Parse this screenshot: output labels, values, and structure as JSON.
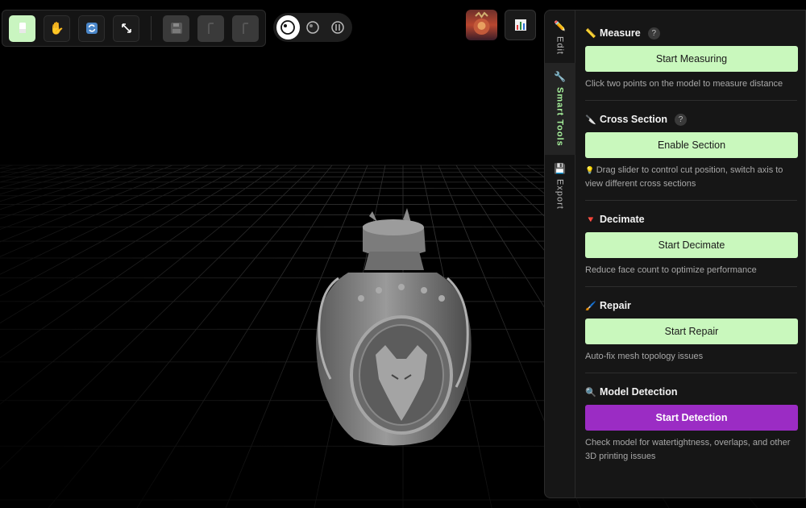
{
  "toolbar": {
    "tools": [
      {
        "name": "select-tool-button",
        "icon": "select-cursor-icon",
        "active": true
      },
      {
        "name": "pan-tool-button",
        "icon": "hand-icon"
      },
      {
        "name": "rotate-tool-button",
        "icon": "rotate-icon"
      },
      {
        "name": "scale-tool-button",
        "icon": "resize-arrows-icon"
      }
    ],
    "actions": [
      {
        "name": "save-button",
        "icon": "floppy-disk-icon",
        "disabled": true
      },
      {
        "name": "undo-button",
        "icon": "undo-icon",
        "disabled": true
      },
      {
        "name": "redo-button",
        "icon": "redo-icon",
        "disabled": true
      }
    ]
  },
  "view_modes": [
    {
      "name": "view-mode-solid",
      "icon": "solid-sphere-icon",
      "active": true
    },
    {
      "name": "view-mode-shaded",
      "icon": "shaded-sphere-icon"
    },
    {
      "name": "view-mode-wireframe",
      "icon": "wireframe-icon"
    }
  ],
  "side_tabs": [
    {
      "label": "Edit",
      "icon": "pencil-icon"
    },
    {
      "label": "Smart Tools",
      "icon": "wrench-icon",
      "active": true
    },
    {
      "label": "Export",
      "icon": "floppy-disk-icon"
    }
  ],
  "sections": [
    {
      "title": "Measure",
      "icon": "ruler-icon",
      "has_help": true,
      "help": "?",
      "button": "Start Measuring",
      "description": "Click two points on the model to measure distance"
    },
    {
      "title": "Cross Section",
      "icon": "knife-icon",
      "has_help": true,
      "help": "?",
      "button": "Enable Section",
      "description_icon": "lightbulb-icon",
      "description": "Drag slider to control cut position, switch axis to view different cross sections"
    },
    {
      "title": "Decimate",
      "icon": "red-triangle-icon",
      "button": "Start Decimate",
      "description": "Reduce face count to optimize performance"
    },
    {
      "title": "Repair",
      "icon": "brush-icon",
      "button": "Start Repair",
      "description": "Auto-fix mesh topology issues"
    },
    {
      "title": "Model Detection",
      "icon": "magnifier-icon",
      "button": "Start Detection",
      "button_style": "purple",
      "description": "Check model for watertightness, overlaps, and other 3D printing issues"
    }
  ],
  "colors": {
    "accent_green": "#c9f8bd",
    "accent_purple": "#9b2cc4",
    "active_tab": "#a6f09b"
  }
}
